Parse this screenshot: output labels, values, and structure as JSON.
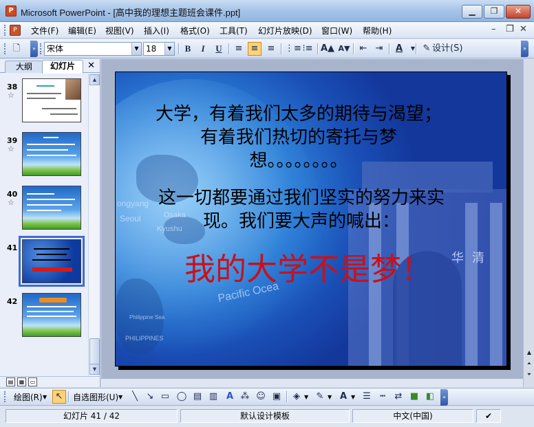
{
  "window": {
    "title": "Microsoft PowerPoint - [高中我的理想主题班会课件.ppt]",
    "minimize": "▁",
    "restore": "❐",
    "close": "✕"
  },
  "menu": {
    "items": [
      "文件(F)",
      "编辑(E)",
      "视图(V)",
      "插入(I)",
      "格式(O)",
      "工具(T)",
      "幻灯片放映(D)",
      "窗口(W)",
      "帮助(H)"
    ],
    "minimize": "–",
    "restore": "❐",
    "close": "✕"
  },
  "format_toolbar": {
    "font_name": "宋体",
    "font_size": "18",
    "bold": "B",
    "italic": "I",
    "underline": "U",
    "design_label": "设计(S)"
  },
  "panel": {
    "tabs": [
      "大纲",
      "幻灯片"
    ],
    "close": "✕",
    "slides": [
      {
        "num": "38",
        "star": "☆"
      },
      {
        "num": "39",
        "star": "☆"
      },
      {
        "num": "40",
        "star": "☆"
      },
      {
        "num": "41",
        "star": ""
      },
      {
        "num": "42",
        "star": ""
      }
    ]
  },
  "slide": {
    "text_1": "大学，有着我们太多的期待与渴望；有着我们热切的寄托与梦想。。。。。。。。",
    "text_2": "这一切都要通过我们坚实的努力来实现。我们要大声的喊出：",
    "text_3": "我的大学不是梦！",
    "map_labels": [
      "Pacific Ocea",
      "Philippine Sea",
      "PHILIPPINES",
      "Seoul",
      "Osaka",
      "Kyushu",
      "ongyang"
    ],
    "gate_glyphs": [
      "清",
      "华"
    ]
  },
  "draw_toolbar": {
    "draw_label": "绘图(R)",
    "autoshape_label": "自选图形(U)"
  },
  "status": {
    "slide_pos": "幻灯片 41 / 42",
    "template": "默认设计模板",
    "language": "中文(中国)"
  },
  "colors": {
    "accent": "#3d6ad6",
    "slide_red_text": "#c8111a",
    "slide_bg": "#1a4fb6"
  }
}
